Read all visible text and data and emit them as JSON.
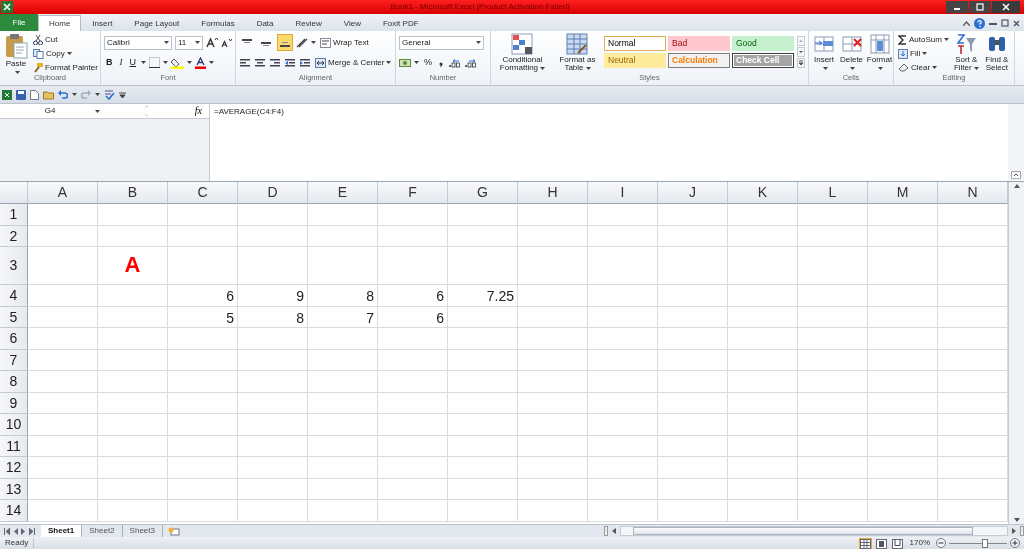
{
  "window": {
    "title": "Book1  -  Microsoft Excel (Product Activation Failed)"
  },
  "file_tab": {
    "label": "File"
  },
  "tabs": [
    {
      "label": "Home",
      "selected": true
    },
    {
      "label": "Insert",
      "selected": false
    },
    {
      "label": "Page Layout",
      "selected": false
    },
    {
      "label": "Formulas",
      "selected": false
    },
    {
      "label": "Data",
      "selected": false
    },
    {
      "label": "Review",
      "selected": false
    },
    {
      "label": "View",
      "selected": false
    },
    {
      "label": "Foxit PDF",
      "selected": false
    }
  ],
  "ribbon": {
    "clipboard": {
      "label": "Clipboard",
      "paste": "Paste",
      "cut": "Cut",
      "copy": "Copy",
      "format_painter": "Format Painter"
    },
    "font": {
      "label": "Font",
      "name": "Calibri",
      "size": "11",
      "bold": "B",
      "italic": "I",
      "underline": "U"
    },
    "alignment": {
      "label": "Alignment",
      "vertical": [
        {
          "selected": false
        },
        {
          "selected": false
        },
        {
          "selected": true
        }
      ],
      "wrap_text": "Wrap Text",
      "merge_center": "Merge & Center"
    },
    "number": {
      "label": "Number",
      "format": "General",
      "percent": "%"
    },
    "styles": {
      "label": "Styles",
      "conditional_formatting": "Conditional Formatting",
      "format_as_table": "Format as Table",
      "cell_styles": [
        {
          "label": "Normal",
          "kind": "normal"
        },
        {
          "label": "Bad",
          "kind": "bad"
        },
        {
          "label": "Good",
          "kind": "good"
        },
        {
          "label": "Neutral",
          "kind": "neutral"
        },
        {
          "label": "Calculation",
          "kind": "calculation"
        },
        {
          "label": "Check Cell",
          "kind": "check"
        }
      ]
    },
    "cells": {
      "label": "Cells",
      "buttons": [
        {
          "label": "Insert",
          "kind": "insert"
        },
        {
          "label": "Delete",
          "kind": "delete"
        },
        {
          "label": "Format",
          "kind": "format"
        }
      ]
    },
    "editing": {
      "label": "Editing",
      "autosum": "AutoSum",
      "fill": "Fill",
      "clear": "Clear",
      "sort_filter": "Sort & Filter",
      "find_select": "Find & Select"
    }
  },
  "formula_bar": {
    "name_box": "G4",
    "fx": "fx",
    "formula": "=AVERAGE(C4:F4)"
  },
  "sheet": {
    "columns": [
      "A",
      "B",
      "C",
      "D",
      "E",
      "F",
      "G",
      "H",
      "I",
      "J",
      "K",
      "L",
      "M",
      "N"
    ],
    "rows": [
      {
        "header": "1"
      },
      {
        "header": "2"
      },
      {
        "header": "3",
        "cells": [
          null,
          {
            "text": "A",
            "kind": "heading"
          }
        ]
      },
      {
        "header": "4",
        "cells": [
          null,
          null,
          {
            "text": "6",
            "kind": "number"
          },
          {
            "text": "9",
            "kind": "number"
          },
          {
            "text": "8",
            "kind": "number"
          },
          {
            "text": "6",
            "kind": "number"
          },
          {
            "text": "7.25",
            "kind": "number"
          }
        ]
      },
      {
        "header": "5",
        "cells": [
          null,
          null,
          {
            "text": "5",
            "kind": "number"
          },
          {
            "text": "8",
            "kind": "number"
          },
          {
            "text": "7",
            "kind": "number"
          },
          {
            "text": "6",
            "kind": "number"
          }
        ]
      },
      {
        "header": "6"
      },
      {
        "header": "7"
      },
      {
        "header": "8"
      },
      {
        "header": "9"
      },
      {
        "header": "10"
      },
      {
        "header": "11"
      },
      {
        "header": "12"
      },
      {
        "header": "13"
      },
      {
        "header": "14"
      }
    ]
  },
  "sheet_tabs": [
    {
      "label": "Sheet1",
      "selected": true
    },
    {
      "label": "Sheet2",
      "selected": false
    },
    {
      "label": "Sheet3",
      "selected": false
    }
  ],
  "status_bar": {
    "status": "Ready",
    "views": [
      {
        "selected": true
      },
      {
        "selected": false
      },
      {
        "selected": false
      }
    ],
    "zoom": "170%",
    "zoom_slider": {
      "level": 0.62
    }
  }
}
